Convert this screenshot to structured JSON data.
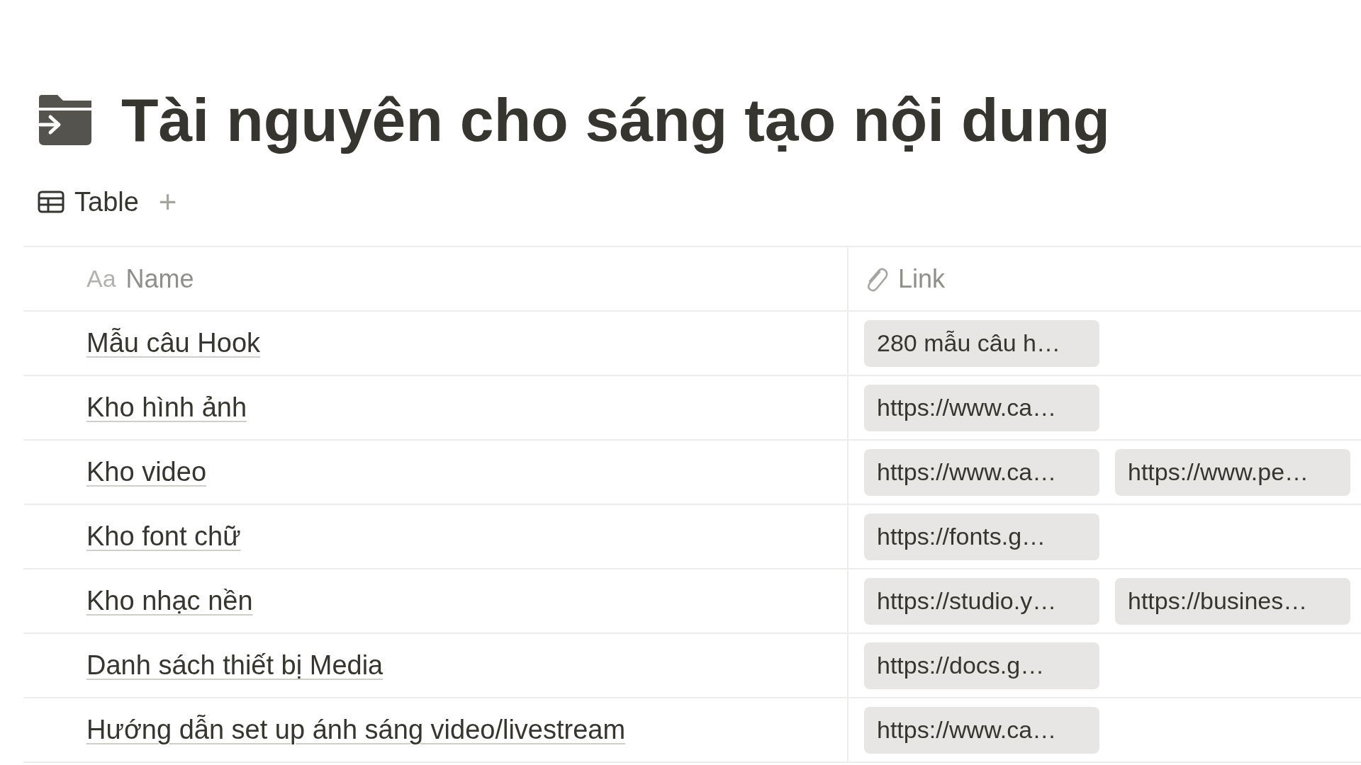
{
  "page": {
    "title": "Tài nguyên cho sáng tạo nội dung"
  },
  "views": [
    {
      "label": "Table",
      "selected": true
    }
  ],
  "add_view": "+",
  "table": {
    "columns": [
      {
        "kind": "text",
        "icon_text": "Aa",
        "label": "Name"
      },
      {
        "kind": "link",
        "label": "Link"
      }
    ],
    "rows": [
      {
        "name": "Mẫu câu Hook",
        "links": [
          "280 mẫu câu h…"
        ]
      },
      {
        "name": "Kho hình ảnh",
        "links": [
          "https://www.ca…"
        ]
      },
      {
        "name": "Kho video",
        "links": [
          "https://www.ca…",
          "https://www.pe…"
        ]
      },
      {
        "name": "Kho font chữ",
        "links": [
          "https://fonts.g…"
        ]
      },
      {
        "name": "Kho nhạc nền",
        "links": [
          "https://studio.y…",
          "https://busines…"
        ]
      },
      {
        "name": "Danh sách thiết bị Media",
        "links": [
          "https://docs.g…"
        ]
      },
      {
        "name": "Hướng dẫn set up ánh sáng video/livestream",
        "links": [
          "https://www.ca…"
        ]
      }
    ]
  }
}
